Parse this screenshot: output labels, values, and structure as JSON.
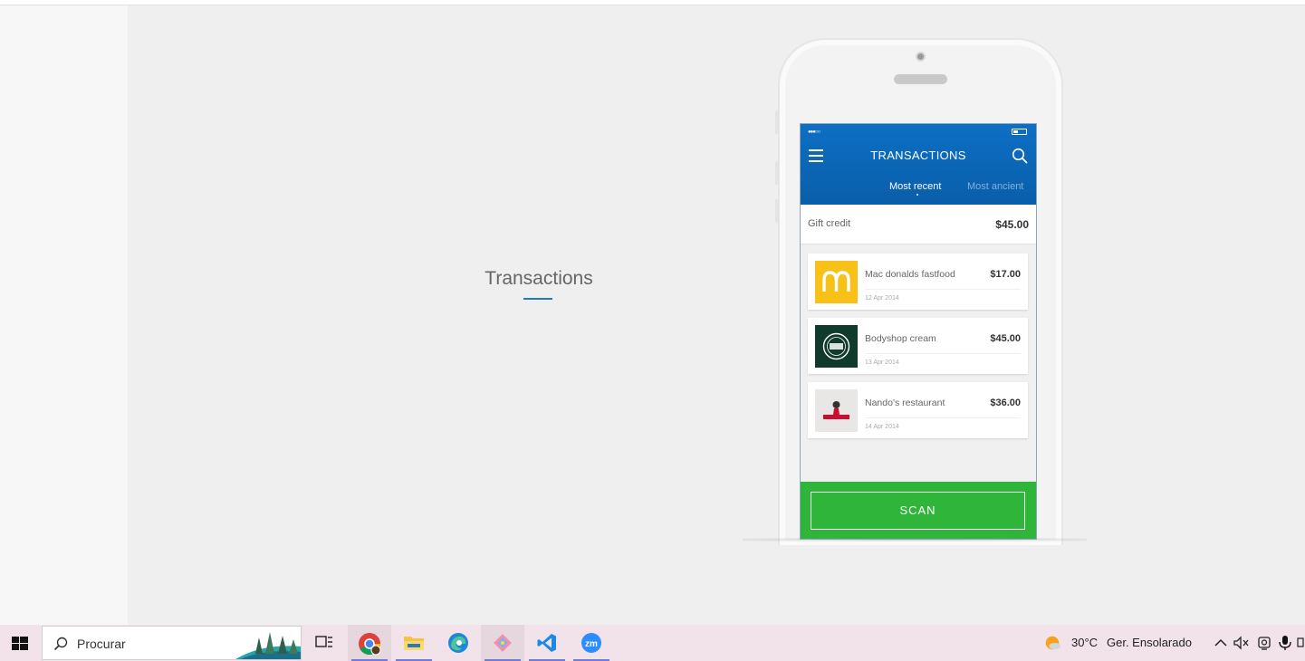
{
  "page": {
    "heading": "Transactions"
  },
  "phone": {
    "app_title": "TRANSACTIONS",
    "status_dots": "●●●○○",
    "tabs": {
      "recent": "Most recent",
      "ancient": "Most ancient"
    },
    "credit": {
      "label": "Gift credit",
      "value": "$45.00"
    },
    "transactions": [
      {
        "name": "Mac donalds fastfood",
        "amount": "$17.00",
        "date": "12 Apr 2014",
        "logo": "mcdonalds-logo"
      },
      {
        "name": "Bodyshop cream",
        "amount": "$45.00",
        "date": "13 Apr 2014",
        "logo": "bodyshop-logo"
      },
      {
        "name": "Nando's restaurant",
        "amount": "$36.00",
        "date": "14 Apr 2014",
        "logo": "nandos-logo"
      }
    ],
    "scan_label": "SCAN",
    "colors": {
      "header": "#0d6fc4",
      "scan": "#2eb53a",
      "accent_line": "#1d7bc9"
    }
  },
  "taskbar": {
    "search_placeholder": "Procurar",
    "weather_temp": "30°C",
    "weather_text": "Ger. Ensolarado",
    "apps": [
      "task-view-icon",
      "chrome-icon",
      "file-explorer-icon",
      "edge-icon",
      "git-icon",
      "vscode-icon",
      "zoom-icon"
    ]
  }
}
